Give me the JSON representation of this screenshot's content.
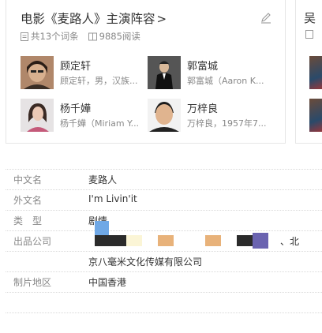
{
  "card": {
    "title": "电影《麦路人》主演阵容",
    "chevron": ">",
    "entries_count": "共13个词条",
    "views": "9885阅读",
    "people": [
      {
        "name": "顾定轩",
        "desc": "顾定轩，男，汉族..."
      },
      {
        "name": "郭富城",
        "desc": "郭富城（Aaron K..."
      },
      {
        "name": "杨千嬅",
        "desc": "杨千嬅（Miriam Y..."
      },
      {
        "name": "万梓良",
        "desc": "万梓良，1957年7..."
      }
    ]
  },
  "next_card": {
    "title": "吴"
  },
  "info": {
    "chinese_name_label": "中文名",
    "chinese_name_value": "麦路人",
    "foreign_name_label": "外文名",
    "foreign_name_value": "I'm Livin'it",
    "genre_label": "类　型",
    "genre_value": "剧情",
    "company_label": "出品公司",
    "company_suffix": "、北",
    "company_value_2": "京八毫米文化传媒有限公司",
    "region_label": "制片地区",
    "region_value": "中国香港"
  }
}
